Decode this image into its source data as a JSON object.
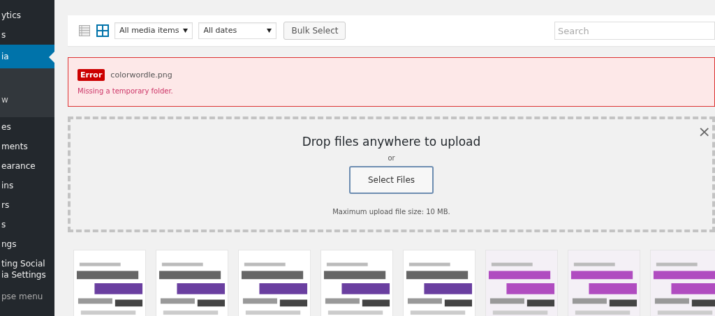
{
  "sidebar": {
    "items": [
      {
        "label": "ytics",
        "selected": false
      },
      {
        "label": "s",
        "selected": false
      },
      {
        "label": "ia",
        "selected": true,
        "children": [
          {
            "label": "w",
            "selected": false
          }
        ]
      },
      {
        "label": "es",
        "selected": false
      },
      {
        "label": "ments",
        "selected": false
      },
      {
        "label": "earance",
        "selected": false
      },
      {
        "label": "ins",
        "selected": false
      },
      {
        "label": "rs",
        "selected": false
      },
      {
        "label": "s",
        "selected": false
      },
      {
        "label": "ngs",
        "selected": false
      },
      {
        "label": "ting Social\nia Settings",
        "selected": false
      }
    ],
    "collapse": "pse menu"
  },
  "toolbar": {
    "views": [
      {
        "kind": "list",
        "selected": false
      },
      {
        "kind": "grid",
        "selected": true
      }
    ],
    "filters": [
      "All media items",
      "All dates"
    ],
    "bulk_select": "Bulk Select",
    "search": {
      "placeholder": "Search"
    }
  },
  "error": {
    "badge": "Error",
    "file": "colorwordle.png",
    "message": "Missing a temporary folder."
  },
  "uploader": {
    "title": "Drop files anywhere to upload",
    "or": "or",
    "button": "Select Files",
    "max_size": "Maximum upload file size: 10 MB.",
    "close": "×"
  },
  "thumbnails": [
    {
      "kind": "wordcloud"
    },
    {
      "kind": "wordcloud"
    },
    {
      "kind": "wordcloud"
    },
    {
      "kind": "wordcloud"
    },
    {
      "kind": "wordcloud"
    },
    {
      "kind": "wordcloud-grey"
    },
    {
      "kind": "wordcloud-grey"
    },
    {
      "kind": "wordcloud-grey"
    }
  ]
}
